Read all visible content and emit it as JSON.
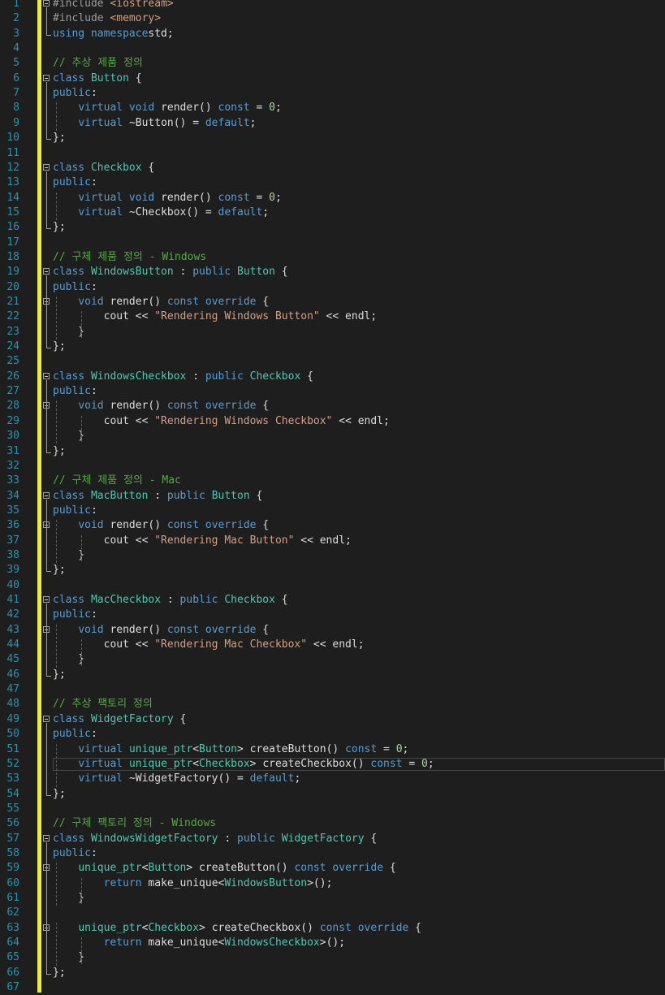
{
  "editor": {
    "language": "cpp",
    "current_line": 52,
    "colors": {
      "background": "#1e1e1e",
      "line_number": "#2b91af",
      "keyword": "#569cd6",
      "type": "#4ec9b0",
      "string": "#d69d85",
      "comment": "#57a64a",
      "change_bar": "#e8e85a"
    },
    "lines": [
      {
        "n": "1",
        "fold": true,
        "t": [
          [
            "pp",
            "#include "
          ],
          [
            "inc",
            "<iostream>"
          ]
        ]
      },
      {
        "n": "2",
        "t": [
          [
            "pp",
            "#include "
          ],
          [
            "inc",
            "<memory>"
          ]
        ]
      },
      {
        "n": "3",
        "t": [
          [
            "kw",
            "using namespace"
          ],
          [
            "",
            "std;"
          ]
        ]
      },
      {
        "n": "4",
        "t": []
      },
      {
        "n": "5",
        "t": [
          [
            "cm",
            "// 추상 제품 정의"
          ]
        ]
      },
      {
        "n": "6",
        "fold": true,
        "t": [
          [
            "kw",
            "class "
          ],
          [
            "ty",
            "Button"
          ],
          [
            "",
            " {"
          ]
        ]
      },
      {
        "n": "7",
        "t": [
          [
            "kw",
            "public"
          ],
          [
            "",
            ":"
          ]
        ]
      },
      {
        "n": "8",
        "t": [
          [
            "",
            "    "
          ],
          [
            "kw",
            "virtual void "
          ],
          [
            "",
            "render() "
          ],
          [
            "kw",
            "const"
          ],
          [
            "",
            " = "
          ],
          [
            "num",
            "0"
          ],
          [
            "",
            ";"
          ]
        ]
      },
      {
        "n": "9",
        "t": [
          [
            "",
            "    "
          ],
          [
            "kw",
            "virtual "
          ],
          [
            "",
            "~Button() = "
          ],
          [
            "kw",
            "default"
          ],
          [
            "",
            ";"
          ]
        ]
      },
      {
        "n": "10",
        "t": [
          [
            "",
            "};"
          ]
        ]
      },
      {
        "n": "11",
        "t": []
      },
      {
        "n": "12",
        "fold": true,
        "t": [
          [
            "kw",
            "class "
          ],
          [
            "ty",
            "Checkbox"
          ],
          [
            "",
            " {"
          ]
        ]
      },
      {
        "n": "13",
        "t": [
          [
            "kw",
            "public"
          ],
          [
            "",
            ":"
          ]
        ]
      },
      {
        "n": "14",
        "t": [
          [
            "",
            "    "
          ],
          [
            "kw",
            "virtual void "
          ],
          [
            "",
            "render() "
          ],
          [
            "kw",
            "const"
          ],
          [
            "",
            " = "
          ],
          [
            "num",
            "0"
          ],
          [
            "",
            ";"
          ]
        ]
      },
      {
        "n": "15",
        "t": [
          [
            "",
            "    "
          ],
          [
            "kw",
            "virtual "
          ],
          [
            "",
            "~Checkbox() = "
          ],
          [
            "kw",
            "default"
          ],
          [
            "",
            ";"
          ]
        ]
      },
      {
        "n": "16",
        "t": [
          [
            "",
            "};"
          ]
        ]
      },
      {
        "n": "17",
        "t": []
      },
      {
        "n": "18",
        "t": [
          [
            "cm",
            "// 구체 제품 정의 - Windows"
          ]
        ]
      },
      {
        "n": "19",
        "fold": true,
        "t": [
          [
            "kw",
            "class "
          ],
          [
            "ty",
            "WindowsButton"
          ],
          [
            "",
            " : "
          ],
          [
            "kw",
            "public "
          ],
          [
            "ty",
            "Button"
          ],
          [
            "",
            " {"
          ]
        ]
      },
      {
        "n": "20",
        "t": [
          [
            "kw",
            "public"
          ],
          [
            "",
            ":"
          ]
        ]
      },
      {
        "n": "21",
        "fold": true,
        "t": [
          [
            "",
            "    "
          ],
          [
            "kw",
            "void "
          ],
          [
            "",
            "render() "
          ],
          [
            "kw",
            "const override"
          ],
          [
            "",
            " {"
          ]
        ]
      },
      {
        "n": "22",
        "t": [
          [
            "",
            "        cout << "
          ],
          [
            "str",
            "\"Rendering Windows Button\""
          ],
          [
            "",
            " << endl;"
          ]
        ]
      },
      {
        "n": "23",
        "t": [
          [
            "",
            "    }"
          ]
        ]
      },
      {
        "n": "24",
        "t": [
          [
            "",
            "};"
          ]
        ]
      },
      {
        "n": "25",
        "t": []
      },
      {
        "n": "26",
        "fold": true,
        "t": [
          [
            "kw",
            "class "
          ],
          [
            "ty",
            "WindowsCheckbox"
          ],
          [
            "",
            " : "
          ],
          [
            "kw",
            "public "
          ],
          [
            "ty",
            "Checkbox"
          ],
          [
            "",
            " {"
          ]
        ]
      },
      {
        "n": "27",
        "t": [
          [
            "kw",
            "public"
          ],
          [
            "",
            ":"
          ]
        ]
      },
      {
        "n": "28",
        "fold": true,
        "t": [
          [
            "",
            "    "
          ],
          [
            "kw",
            "void "
          ],
          [
            "",
            "render() "
          ],
          [
            "kw",
            "const override"
          ],
          [
            "",
            " {"
          ]
        ]
      },
      {
        "n": "29",
        "t": [
          [
            "",
            "        cout << "
          ],
          [
            "str",
            "\"Rendering Windows Checkbox\""
          ],
          [
            "",
            " << endl;"
          ]
        ]
      },
      {
        "n": "30",
        "t": [
          [
            "",
            "    }"
          ]
        ]
      },
      {
        "n": "31",
        "t": [
          [
            "",
            "};"
          ]
        ]
      },
      {
        "n": "32",
        "t": []
      },
      {
        "n": "33",
        "t": [
          [
            "cm",
            "// 구체 제품 정의 - Mac"
          ]
        ]
      },
      {
        "n": "34",
        "fold": true,
        "t": [
          [
            "kw",
            "class "
          ],
          [
            "ty",
            "MacButton"
          ],
          [
            "",
            " : "
          ],
          [
            "kw",
            "public "
          ],
          [
            "ty",
            "Button"
          ],
          [
            "",
            " {"
          ]
        ]
      },
      {
        "n": "35",
        "t": [
          [
            "kw",
            "public"
          ],
          [
            "",
            ":"
          ]
        ]
      },
      {
        "n": "36",
        "fold": true,
        "t": [
          [
            "",
            "    "
          ],
          [
            "kw",
            "void "
          ],
          [
            "",
            "render() "
          ],
          [
            "kw",
            "const override"
          ],
          [
            "",
            " {"
          ]
        ]
      },
      {
        "n": "37",
        "t": [
          [
            "",
            "        cout << "
          ],
          [
            "str",
            "\"Rendering Mac Button\""
          ],
          [
            "",
            " << endl;"
          ]
        ]
      },
      {
        "n": "38",
        "t": [
          [
            "",
            "    }"
          ]
        ]
      },
      {
        "n": "39",
        "t": [
          [
            "",
            "};"
          ]
        ]
      },
      {
        "n": "40",
        "t": []
      },
      {
        "n": "41",
        "fold": true,
        "t": [
          [
            "kw",
            "class "
          ],
          [
            "ty",
            "MacCheckbox"
          ],
          [
            "",
            " : "
          ],
          [
            "kw",
            "public "
          ],
          [
            "ty",
            "Checkbox"
          ],
          [
            "",
            " {"
          ]
        ]
      },
      {
        "n": "42",
        "t": [
          [
            "kw",
            "public"
          ],
          [
            "",
            ":"
          ]
        ]
      },
      {
        "n": "43",
        "fold": true,
        "t": [
          [
            "",
            "    "
          ],
          [
            "kw",
            "void "
          ],
          [
            "",
            "render() "
          ],
          [
            "kw",
            "const override"
          ],
          [
            "",
            " {"
          ]
        ]
      },
      {
        "n": "44",
        "t": [
          [
            "",
            "        cout << "
          ],
          [
            "str",
            "\"Rendering Mac Checkbox\""
          ],
          [
            "",
            " << endl;"
          ]
        ]
      },
      {
        "n": "45",
        "t": [
          [
            "",
            "    }"
          ]
        ]
      },
      {
        "n": "46",
        "t": [
          [
            "",
            "};"
          ]
        ]
      },
      {
        "n": "47",
        "t": []
      },
      {
        "n": "48",
        "t": [
          [
            "cm",
            "// 추상 팩토리 정의"
          ]
        ]
      },
      {
        "n": "49",
        "fold": true,
        "t": [
          [
            "kw",
            "class "
          ],
          [
            "ty",
            "WidgetFactory"
          ],
          [
            "",
            " {"
          ]
        ]
      },
      {
        "n": "50",
        "t": [
          [
            "kw",
            "public"
          ],
          [
            "",
            ":"
          ]
        ]
      },
      {
        "n": "51",
        "t": [
          [
            "",
            "    "
          ],
          [
            "kw",
            "virtual "
          ],
          [
            "ty",
            "unique_ptr"
          ],
          [
            "",
            "<"
          ],
          [
            "ty",
            "Button"
          ],
          [
            "",
            "> createButton() "
          ],
          [
            "kw",
            "const"
          ],
          [
            "",
            " = "
          ],
          [
            "num",
            "0"
          ],
          [
            "",
            ";"
          ]
        ]
      },
      {
        "n": "52",
        "t": [
          [
            "",
            "    "
          ],
          [
            "kw",
            "virtual "
          ],
          [
            "ty",
            "unique_ptr"
          ],
          [
            "",
            "<"
          ],
          [
            "ty",
            "Checkbox"
          ],
          [
            "",
            "> createCheckbox() "
          ],
          [
            "kw",
            "const"
          ],
          [
            "",
            " = "
          ],
          [
            "num",
            "0"
          ],
          [
            "",
            ";"
          ]
        ]
      },
      {
        "n": "53",
        "t": [
          [
            "",
            "    "
          ],
          [
            "kw",
            "virtual "
          ],
          [
            "",
            "~WidgetFactory() = "
          ],
          [
            "kw",
            "default"
          ],
          [
            "",
            ";"
          ]
        ]
      },
      {
        "n": "54",
        "t": [
          [
            "",
            "};"
          ]
        ]
      },
      {
        "n": "55",
        "t": []
      },
      {
        "n": "56",
        "t": [
          [
            "cm",
            "// 구체 팩토리 정의 - Windows"
          ]
        ]
      },
      {
        "n": "57",
        "fold": true,
        "t": [
          [
            "kw",
            "class "
          ],
          [
            "ty",
            "WindowsWidgetFactory"
          ],
          [
            "",
            " : "
          ],
          [
            "kw",
            "public "
          ],
          [
            "ty",
            "WidgetFactory"
          ],
          [
            "",
            " {"
          ]
        ]
      },
      {
        "n": "58",
        "t": [
          [
            "kw",
            "public"
          ],
          [
            "",
            ":"
          ]
        ]
      },
      {
        "n": "59",
        "fold": true,
        "t": [
          [
            "",
            "    "
          ],
          [
            "ty",
            "unique_ptr"
          ],
          [
            "",
            "<"
          ],
          [
            "ty",
            "Button"
          ],
          [
            "",
            "> createButton() "
          ],
          [
            "kw",
            "const override"
          ],
          [
            "",
            " {"
          ]
        ]
      },
      {
        "n": "60",
        "t": [
          [
            "",
            "        "
          ],
          [
            "kw",
            "return "
          ],
          [
            "",
            "make_unique<"
          ],
          [
            "ty",
            "WindowsButton"
          ],
          [
            "",
            ">();"
          ]
        ]
      },
      {
        "n": "61",
        "t": [
          [
            "",
            "    }"
          ]
        ]
      },
      {
        "n": "62",
        "t": []
      },
      {
        "n": "63",
        "fold": true,
        "t": [
          [
            "",
            "    "
          ],
          [
            "ty",
            "unique_ptr"
          ],
          [
            "",
            "<"
          ],
          [
            "ty",
            "Checkbox"
          ],
          [
            "",
            "> createCheckbox() "
          ],
          [
            "kw",
            "const override"
          ],
          [
            "",
            " {"
          ]
        ]
      },
      {
        "n": "64",
        "t": [
          [
            "",
            "        "
          ],
          [
            "kw",
            "return "
          ],
          [
            "",
            "make_unique<"
          ],
          [
            "ty",
            "WindowsCheckbox"
          ],
          [
            "",
            ">();"
          ]
        ]
      },
      {
        "n": "65",
        "t": [
          [
            "",
            "    }"
          ]
        ]
      },
      {
        "n": "66",
        "t": [
          [
            "",
            "};"
          ]
        ]
      },
      {
        "n": "67",
        "t": []
      }
    ]
  }
}
